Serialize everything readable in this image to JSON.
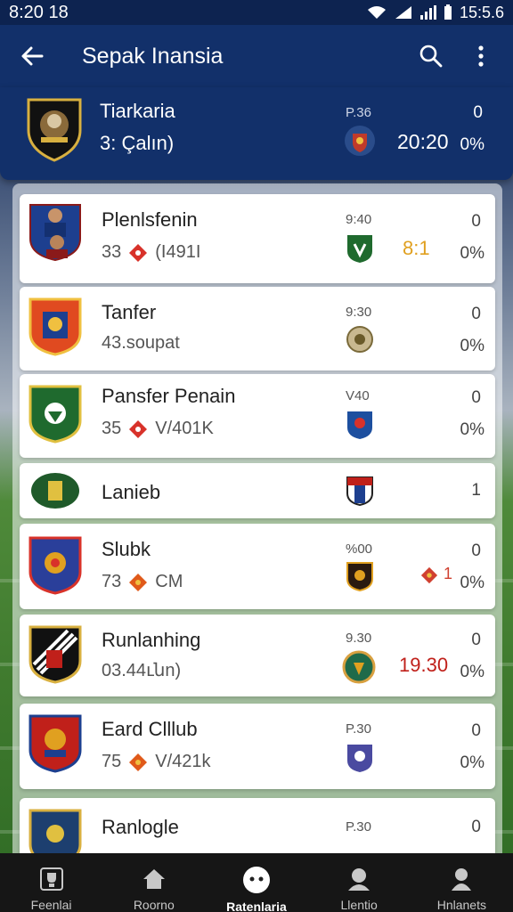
{
  "status_bar": {
    "time": "8:20 18",
    "right_text": "15:5.6"
  },
  "app_bar": {
    "title": "Sepak Inansia"
  },
  "featured": {
    "name": "Tiarkaria",
    "sub": "3: Çalın)",
    "time": "P.36",
    "score": "20:20",
    "right_top": "0",
    "right_pct": "0%"
  },
  "matches": [
    {
      "name": "Plenlsfenin",
      "sub_num": "33",
      "sub_text": "(I491I",
      "time": "9:40",
      "score": "8:1",
      "score_color": "#e0a020",
      "right_top": "0",
      "right_pct": "0%"
    },
    {
      "name": "Tanfer",
      "sub_num": "",
      "sub_text": "43.soupat",
      "time": "9:30",
      "score": "",
      "score_color": "#333333",
      "right_top": "0",
      "right_pct": "0%"
    },
    {
      "name": "Pansfer Penain",
      "sub_num": "35",
      "sub_text": "V/401K",
      "time": "V40",
      "score": "",
      "score_color": "#333333",
      "right_top": "0",
      "right_pct": "0%"
    },
    {
      "name": "Lanieb",
      "sub_num": "",
      "sub_text": "",
      "time": "",
      "score": "",
      "score_color": "#333333",
      "right_top": "1",
      "right_pct": ""
    },
    {
      "name": "Slubk",
      "sub_num": "73",
      "sub_text": "CM",
      "time": "%00",
      "score": "1",
      "score_color": "#d04030",
      "right_top": "0",
      "right_pct": "0%"
    },
    {
      "name": "Runlanhing",
      "sub_num": "",
      "sub_text": "03.44ւնn)",
      "time": "9.30",
      "score": "19.30",
      "score_color": "#c0201a",
      "right_top": "0",
      "right_pct": "0%"
    },
    {
      "name": "Eard Clllub",
      "sub_num": "75",
      "sub_text": "V/421k",
      "time": "P.30",
      "score": "",
      "score_color": "#333333",
      "right_top": "0",
      "right_pct": "0%"
    },
    {
      "name": "Ranlogle",
      "sub_num": "",
      "sub_text": "",
      "time": "P.30",
      "score": "",
      "score_color": "#333333",
      "right_top": "0",
      "right_pct": ""
    }
  ],
  "bottom_nav": [
    {
      "label": "Feenlai",
      "icon": "trophy-icon"
    },
    {
      "label": "Roorno",
      "icon": "home-icon"
    },
    {
      "label": "Ratenlaria",
      "icon": "ball-icon",
      "active": true
    },
    {
      "label": "Llentio",
      "icon": "people-icon"
    },
    {
      "label": "Hnlanets",
      "icon": "profile-icon"
    }
  ],
  "colors": {
    "primary": "#12306a",
    "status": "#0d2350",
    "nav": "#161616"
  }
}
